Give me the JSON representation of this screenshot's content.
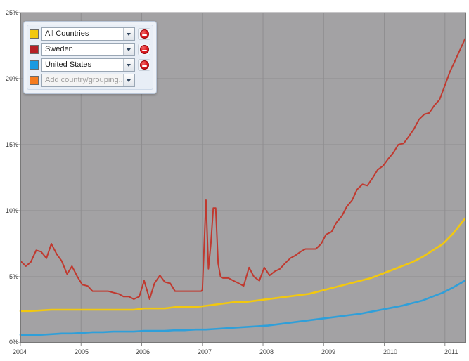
{
  "chart_data": {
    "type": "line",
    "title": "",
    "xlabel": "",
    "ylabel": "",
    "xlim": [
      2004.0,
      2011.35
    ],
    "ylim": [
      0,
      25
    ],
    "y_unit": "%",
    "grid": true,
    "legend_position": "top-left-overlay",
    "x_ticks": [
      "2004",
      "2005",
      "2006",
      "2007",
      "2008",
      "2009",
      "2010",
      "2011"
    ],
    "x_tick_values": [
      2004,
      2005,
      2006,
      2007,
      2008,
      2009,
      2010,
      2011
    ],
    "y_ticks": [
      "0%",
      "5%",
      "10%",
      "15%",
      "20%",
      "25%"
    ],
    "y_tick_values": [
      0,
      5,
      10,
      15,
      20,
      25
    ],
    "series": [
      {
        "name": "Sweden",
        "color": "#c0392f",
        "x": [
          2004.0,
          2004.09,
          2004.17,
          2004.26,
          2004.34,
          2004.43,
          2004.51,
          2004.6,
          2004.68,
          2004.77,
          2004.85,
          2004.94,
          2005.02,
          2005.11,
          2005.19,
          2005.28,
          2005.36,
          2005.45,
          2005.53,
          2005.62,
          2005.7,
          2005.79,
          2005.87,
          2005.96,
          2006.04,
          2006.13,
          2006.21,
          2006.3,
          2006.38,
          2006.47,
          2006.55,
          2006.64,
          2006.72,
          2006.81,
          2006.89,
          2006.98,
          2007.0,
          2007.06,
          2007.1,
          2007.14,
          2007.18,
          2007.22,
          2007.26,
          2007.3,
          2007.34,
          2007.38,
          2007.43,
          2007.51,
          2007.6,
          2007.68,
          2007.77,
          2007.85,
          2007.94,
          2008.02,
          2008.11,
          2008.19,
          2008.28,
          2008.36,
          2008.45,
          2008.53,
          2008.62,
          2008.7,
          2008.79,
          2008.87,
          2008.96,
          2009.04,
          2009.13,
          2009.21,
          2009.3,
          2009.38,
          2009.47,
          2009.55,
          2009.64,
          2009.72,
          2009.81,
          2009.89,
          2009.98,
          2010.06,
          2010.15,
          2010.23,
          2010.32,
          2010.4,
          2010.49,
          2010.57,
          2010.66,
          2010.74,
          2010.83,
          2010.91,
          2011.0,
          2011.08,
          2011.17,
          2011.25,
          2011.33
        ],
        "values": [
          6.2,
          5.8,
          6.1,
          7.0,
          6.9,
          6.4,
          7.5,
          6.7,
          6.2,
          5.2,
          5.8,
          5.0,
          4.4,
          4.3,
          3.9,
          3.9,
          3.9,
          3.9,
          3.8,
          3.7,
          3.5,
          3.5,
          3.3,
          3.5,
          4.7,
          3.3,
          4.5,
          5.1,
          4.6,
          4.5,
          3.9,
          3.9,
          3.9,
          3.9,
          3.9,
          3.9,
          4.0,
          10.8,
          5.6,
          7.5,
          10.2,
          10.2,
          6.0,
          5.0,
          4.9,
          4.9,
          4.9,
          4.7,
          4.5,
          4.3,
          5.7,
          5.0,
          4.7,
          5.7,
          5.1,
          5.4,
          5.6,
          6.0,
          6.4,
          6.6,
          6.9,
          7.1,
          7.1,
          7.1,
          7.5,
          8.2,
          8.4,
          9.1,
          9.6,
          10.3,
          10.8,
          11.6,
          12.0,
          11.9,
          12.5,
          13.1,
          13.4,
          13.9,
          14.4,
          15.0,
          15.1,
          15.6,
          16.2,
          16.9,
          17.3,
          17.4,
          18.0,
          18.4,
          19.5,
          20.5,
          21.4,
          22.2,
          23.0
        ]
      },
      {
        "name": "All Countries",
        "color": "#f2c80f",
        "x": [
          2004.0,
          2004.17,
          2004.34,
          2004.51,
          2004.68,
          2004.85,
          2005.02,
          2005.19,
          2005.36,
          2005.53,
          2005.7,
          2005.87,
          2006.04,
          2006.21,
          2006.38,
          2006.55,
          2006.72,
          2006.89,
          2007.06,
          2007.23,
          2007.4,
          2007.57,
          2007.74,
          2007.91,
          2008.08,
          2008.25,
          2008.42,
          2008.59,
          2008.76,
          2008.93,
          2009.1,
          2009.27,
          2009.44,
          2009.61,
          2009.78,
          2009.95,
          2010.12,
          2010.29,
          2010.46,
          2010.63,
          2010.8,
          2010.97,
          2011.14,
          2011.33
        ],
        "values": [
          2.4,
          2.4,
          2.45,
          2.5,
          2.5,
          2.5,
          2.5,
          2.5,
          2.5,
          2.5,
          2.5,
          2.5,
          2.6,
          2.6,
          2.6,
          2.7,
          2.7,
          2.7,
          2.8,
          2.9,
          3.0,
          3.1,
          3.1,
          3.2,
          3.3,
          3.4,
          3.5,
          3.6,
          3.7,
          3.9,
          4.1,
          4.3,
          4.5,
          4.7,
          4.9,
          5.2,
          5.5,
          5.8,
          6.1,
          6.5,
          7.0,
          7.5,
          8.3,
          9.4
        ]
      },
      {
        "name": "United States",
        "color": "#2f9fd9",
        "x": [
          2004.0,
          2004.17,
          2004.34,
          2004.51,
          2004.68,
          2004.85,
          2005.02,
          2005.19,
          2005.36,
          2005.53,
          2005.7,
          2005.87,
          2006.04,
          2006.21,
          2006.38,
          2006.55,
          2006.72,
          2006.89,
          2007.06,
          2007.23,
          2007.4,
          2007.57,
          2007.74,
          2007.91,
          2008.08,
          2008.25,
          2008.42,
          2008.59,
          2008.76,
          2008.93,
          2009.1,
          2009.27,
          2009.44,
          2009.61,
          2009.78,
          2009.95,
          2010.12,
          2010.29,
          2010.46,
          2010.63,
          2010.8,
          2010.97,
          2011.14,
          2011.33
        ],
        "values": [
          0.6,
          0.6,
          0.6,
          0.65,
          0.7,
          0.7,
          0.75,
          0.8,
          0.8,
          0.85,
          0.85,
          0.85,
          0.9,
          0.9,
          0.9,
          0.95,
          0.95,
          1.0,
          1.0,
          1.05,
          1.1,
          1.15,
          1.2,
          1.25,
          1.3,
          1.4,
          1.5,
          1.6,
          1.7,
          1.8,
          1.9,
          2.0,
          2.1,
          2.2,
          2.35,
          2.5,
          2.65,
          2.8,
          3.0,
          3.2,
          3.5,
          3.8,
          4.2,
          4.7
        ]
      }
    ]
  },
  "legend": {
    "rows": [
      {
        "label": "All Countries",
        "color": "#f2c80f",
        "removable": true,
        "is_placeholder": false
      },
      {
        "label": "Sweden",
        "color": "#b52026",
        "removable": true,
        "is_placeholder": false
      },
      {
        "label": "United States",
        "color": "#1b9ae0",
        "removable": true,
        "is_placeholder": false
      },
      {
        "label": "Add country/grouping..",
        "color": "#f57c20",
        "removable": false,
        "is_placeholder": true
      }
    ]
  },
  "axes": {
    "y_labels": [
      "25%",
      "20%",
      "15%",
      "10%",
      "5%",
      "0%"
    ],
    "x_labels": [
      "2004",
      "2005",
      "2006",
      "2007",
      "2008",
      "2009",
      "2010",
      "2011"
    ]
  },
  "colors": {
    "plot_background": "#a3a2a4",
    "gridline": "#8f8e90",
    "axis_text": "#3a3a3a",
    "page_background": "#ffffff"
  }
}
